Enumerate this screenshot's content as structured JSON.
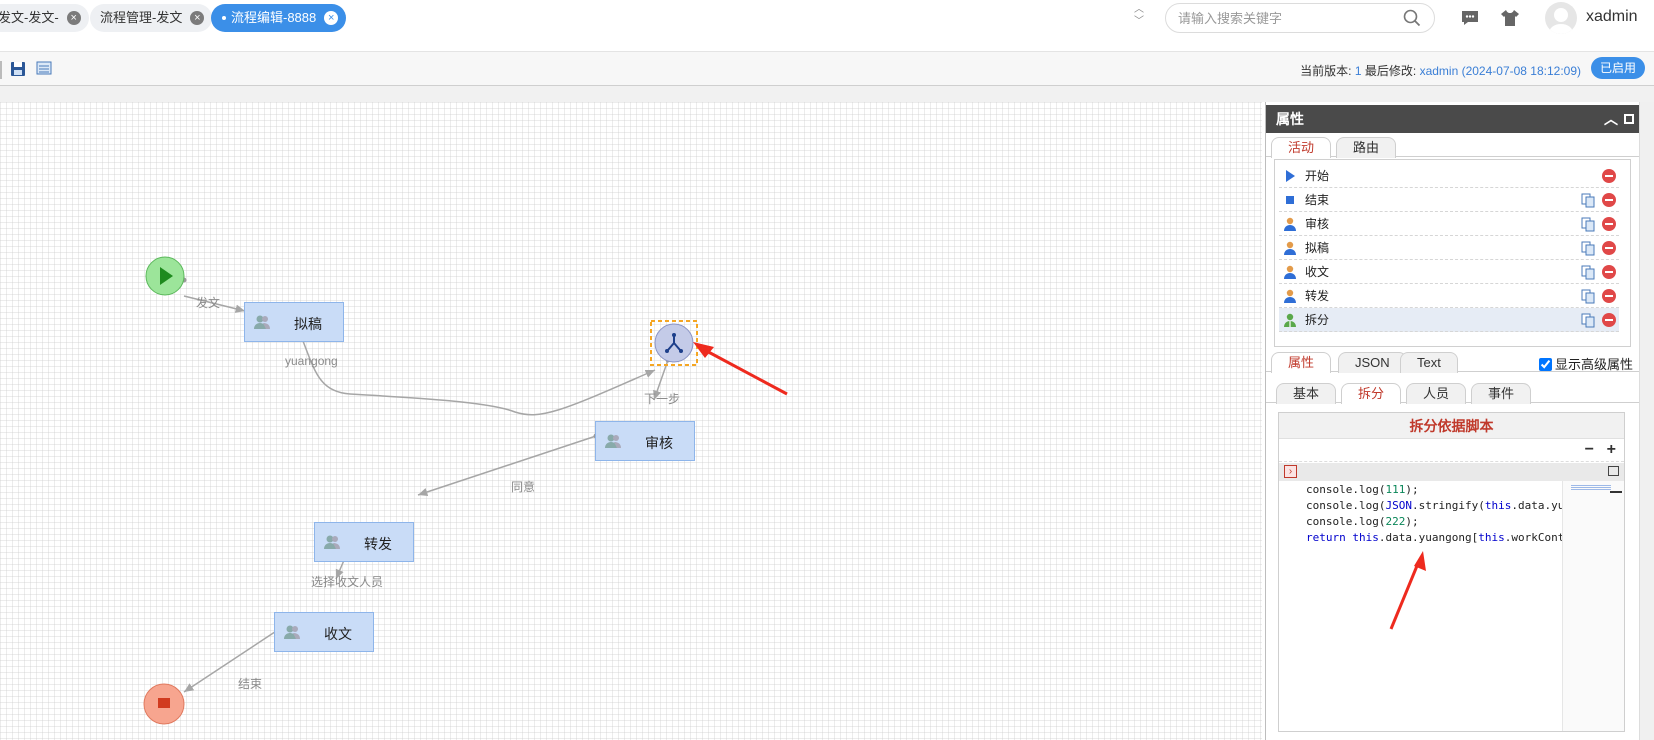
{
  "tabs": [
    {
      "label": "发文-发文-",
      "active": false
    },
    {
      "label": "流程管理-发文",
      "active": false
    },
    {
      "label": "流程编辑-8888",
      "active": true
    }
  ],
  "header": {
    "search_placeholder": "请输入搜索关键字",
    "username": "xadmin"
  },
  "toolbar": {
    "version_label": "当前版本:",
    "version_value": "1",
    "modified_label": "最后修改:",
    "modified_value": "xadmin (2024-07-08 18:12:09)",
    "status_button": "已启用"
  },
  "diagram": {
    "nodes": [
      "拟稿",
      "审核",
      "转发",
      "收文"
    ],
    "edge_labels": [
      "发文",
      "yuangong",
      "下一步",
      "同意",
      "选择收文人员",
      "结束"
    ]
  },
  "props": {
    "title": "属性",
    "top_tabs": [
      "活动",
      "路由"
    ],
    "activities": [
      {
        "name": "开始",
        "icon": "start-icon"
      },
      {
        "name": "结束",
        "icon": "end-icon"
      },
      {
        "name": "审核",
        "icon": "user-icon"
      },
      {
        "name": "拟稿",
        "icon": "user-icon"
      },
      {
        "name": "收文",
        "icon": "user-icon"
      },
      {
        "name": "转发",
        "icon": "user-icon"
      },
      {
        "name": "拆分",
        "icon": "split-icon",
        "selected": true
      }
    ],
    "detail_tabs": [
      "属性",
      "JSON",
      "Text"
    ],
    "advanced_label": "显示高级属性",
    "sub_tabs": [
      "基本",
      "拆分",
      "人员",
      "事件"
    ],
    "script_title": "拆分依据脚本",
    "zoom_minus": "−",
    "zoom_plus": "+"
  },
  "code": [
    "console.log(111);",
    "console.log(JSON.stringify(this.data.yu",
    "console.log(222);",
    "return this.data.yuangong[this.workCont"
  ],
  "colors": {
    "accent": "#3b8fe8",
    "node_fill": "#c9dcf7",
    "selected_tab": "#c0392b",
    "arrow": "#ee2a1e"
  }
}
